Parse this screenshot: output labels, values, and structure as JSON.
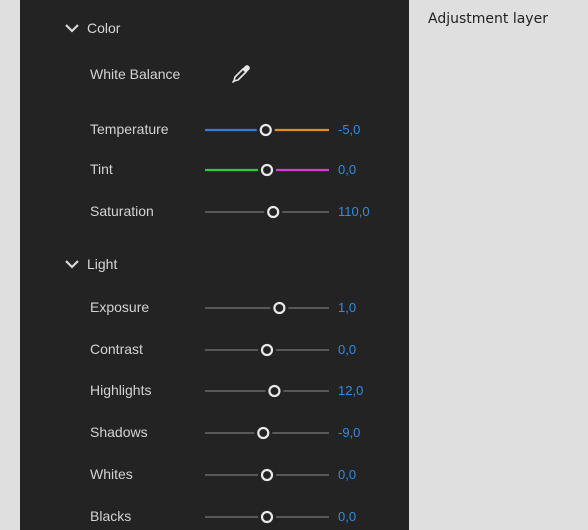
{
  "panel": {
    "accent_value_color": "#2f8ce8",
    "sections": {
      "color": {
        "label": "Color",
        "icon": "chevron-down-icon"
      },
      "light": {
        "label": "Light",
        "icon": "chevron-down-icon"
      }
    },
    "white_balance": {
      "label": "White Balance",
      "icon": "eyedropper-icon"
    },
    "sliders": [
      {
        "key": "temperature",
        "label": "Temperature",
        "value": "-5,0",
        "position": 0.49,
        "left_color": "#2f7de2",
        "right_color": "#e48c1c"
      },
      {
        "key": "tint",
        "label": "Tint",
        "value": "0,0",
        "position": 0.5,
        "left_color": "#2ecc3a",
        "right_color": "#d838d8"
      },
      {
        "key": "saturation",
        "label": "Saturation",
        "value": "110,0",
        "position": 0.55
      },
      {
        "key": "exposure",
        "label": "Exposure",
        "value": "1,0",
        "position": 0.6
      },
      {
        "key": "contrast",
        "label": "Contrast",
        "value": "0,0",
        "position": 0.5
      },
      {
        "key": "highlights",
        "label": "Highlights",
        "value": "12,0",
        "position": 0.56
      },
      {
        "key": "shadows",
        "label": "Shadows",
        "value": "-9,0",
        "position": 0.47
      },
      {
        "key": "whites",
        "label": "Whites",
        "value": "0,0",
        "position": 0.5
      },
      {
        "key": "blacks",
        "label": "Blacks",
        "value": "0,0",
        "position": 0.5
      }
    ]
  },
  "caption": "Adjustment layer"
}
